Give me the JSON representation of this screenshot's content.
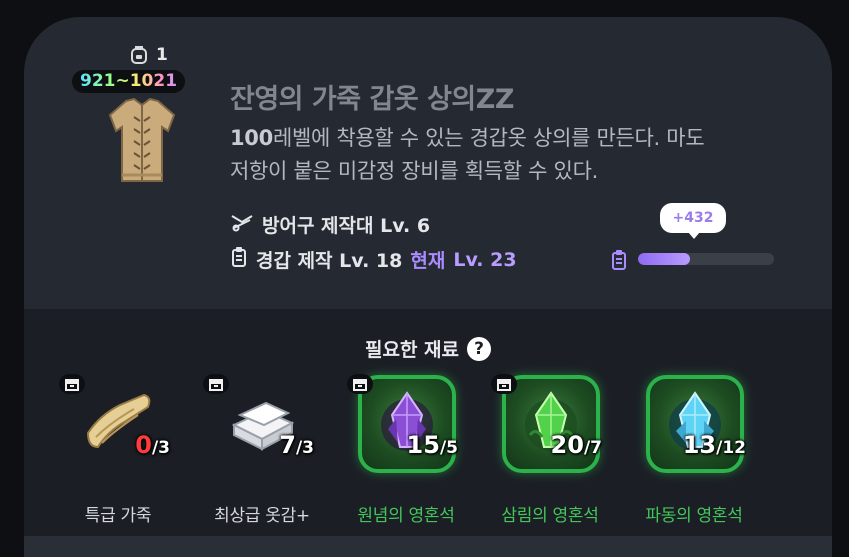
{
  "item": {
    "count": "1",
    "level_range": "921~1021",
    "title": "잔영의 가죽 갑옷 상의ZZ",
    "desc_level": "100",
    "desc_rest_line1": "레벨에 착용할 수 있는 경갑옷 상의를 만든다. 마도",
    "desc_line2": "저항이 붙은 미감정 장비를 획득할 수 있다.",
    "icons": [
      "backpack-icon",
      "leather-armor-icon"
    ]
  },
  "requirements": {
    "station": "방어구 제작대 Lv. 6",
    "skill": "경갑 제작 Lv. 18",
    "current_label": "현재",
    "current_level": "Lv. 23"
  },
  "exp": {
    "gain": "+432",
    "progress": 0.38,
    "icon": "craft-book-icon"
  },
  "materials": {
    "title": "필요한 재료",
    "items": [
      {
        "name": "특급 가죽",
        "have": "0",
        "need": "/3",
        "insufficient": true,
        "frame": "none",
        "icon": "scroll-icon",
        "label_color": "#d6d8dc"
      },
      {
        "name": "최상급 옷감+",
        "have": "7",
        "need": "/3",
        "insufficient": false,
        "frame": "none",
        "icon": "cloth-icon",
        "label_color": "#d6d8dc"
      },
      {
        "name": "원념의 영혼석",
        "have": "15",
        "need": "/5",
        "insufficient": false,
        "frame": "green",
        "icon": "purple-crystal-icon",
        "label_color": "#43c55a"
      },
      {
        "name": "삼림의 영혼석",
        "have": "20",
        "need": "/7",
        "insufficient": false,
        "frame": "green",
        "icon": "green-crystal-icon",
        "label_color": "#43c55a"
      },
      {
        "name": "파동의 영혼석",
        "have": "13",
        "need": "/12",
        "insufficient": false,
        "frame": "green",
        "icon": "blue-crystal-icon",
        "label_color": "#43c55a"
      }
    ]
  },
  "colors": {
    "card_bg": "#252931",
    "materials_bg": "#1b1f25",
    "accent_purple": "#a98cff",
    "rare_green": "#2bb24a",
    "insufficient_red": "#ff3b3b"
  }
}
